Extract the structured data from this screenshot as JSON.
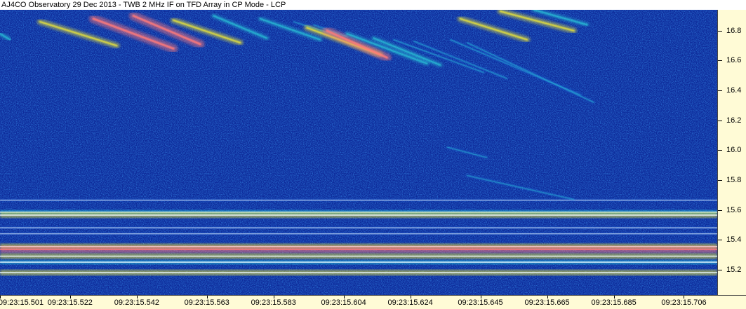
{
  "title": "AJ4CO Observatory 29 Dec 2013 - TWB 2 MHz IF on TFD Array in CP Mode - LCP",
  "colors": {
    "background_noise": "#0d2a9a",
    "low_intensity": "#1e5fd8",
    "mid_intensity": "#29c7d8",
    "high_intensity": "#e9e43a",
    "peak_intensity": "#ff7a7a",
    "axis_panel": "#fffbd6"
  },
  "chart_data": {
    "type": "heatmap",
    "title": "AJ4CO Observatory 29 Dec 2013 - TWB 2 MHz IF on TFD Array in CP Mode - LCP",
    "xlabel": "",
    "ylabel": "",
    "x_ticks": [
      "09:23:15.501",
      "09:23:15.522",
      "09:23:15.542",
      "09:23:15.563",
      "09:23:15.583",
      "09:23:15.604",
      "09:23:15.624",
      "09:23:15.645",
      "09:23:15.665",
      "09:23:15.685",
      "09:23:15.706"
    ],
    "y_ticks": [
      "16.8",
      "16.6",
      "16.4",
      "16.2",
      "16.0",
      "15.8",
      "15.6",
      "15.4",
      "15.2"
    ],
    "ylim": [
      15.03,
      16.94
    ],
    "xlim": [
      "09:23:15.501",
      "09:23:15.716"
    ],
    "grid": false,
    "y_axis_side": "right",
    "interference_bands_mhz": [
      {
        "f": 15.665,
        "level": "low"
      },
      {
        "f": 15.585,
        "level": "medium"
      },
      {
        "f": 15.565,
        "level": "high"
      },
      {
        "f": 15.48,
        "level": "low"
      },
      {
        "f": 15.44,
        "level": "low"
      },
      {
        "f": 15.355,
        "level": "high"
      },
      {
        "f": 15.335,
        "level": "peak"
      },
      {
        "f": 15.29,
        "level": "high"
      },
      {
        "f": 15.25,
        "level": "medium"
      },
      {
        "f": 15.18,
        "level": "high"
      }
    ],
    "emission_bursts": [
      {
        "t_start": 0.0,
        "f_start": 16.78,
        "t_end": 0.003,
        "f_end": 16.74,
        "level": "medium"
      },
      {
        "t_start": 0.012,
        "f_start": 16.86,
        "t_end": 0.035,
        "f_end": 16.7,
        "level": "high"
      },
      {
        "t_start": 0.028,
        "f_start": 16.88,
        "t_end": 0.052,
        "f_end": 16.68,
        "level": "peak"
      },
      {
        "t_start": 0.04,
        "f_start": 16.9,
        "t_end": 0.06,
        "f_end": 16.71,
        "level": "peak"
      },
      {
        "t_start": 0.052,
        "f_start": 16.87,
        "t_end": 0.072,
        "f_end": 16.72,
        "level": "high"
      },
      {
        "t_start": 0.064,
        "f_start": 16.9,
        "t_end": 0.08,
        "f_end": 16.75,
        "level": "medium"
      },
      {
        "t_start": 0.078,
        "f_start": 16.88,
        "t_end": 0.096,
        "f_end": 16.74,
        "level": "medium"
      },
      {
        "t_start": 0.088,
        "f_start": 16.86,
        "t_end": 0.101,
        "f_end": 16.77,
        "level": "low"
      },
      {
        "t_start": 0.094,
        "f_start": 16.84,
        "t_end": 0.104,
        "f_end": 16.76,
        "level": "low"
      },
      {
        "t_start": 0.092,
        "f_start": 16.82,
        "t_end": 0.114,
        "f_end": 16.64,
        "level": "high"
      },
      {
        "t_start": 0.098,
        "f_start": 16.8,
        "t_end": 0.116,
        "f_end": 16.62,
        "level": "peak"
      },
      {
        "t_start": 0.104,
        "f_start": 16.78,
        "t_end": 0.128,
        "f_end": 16.58,
        "level": "medium"
      },
      {
        "t_start": 0.112,
        "f_start": 16.75,
        "t_end": 0.132,
        "f_end": 16.57,
        "level": "medium"
      },
      {
        "t_start": 0.118,
        "f_start": 16.74,
        "t_end": 0.145,
        "f_end": 16.52,
        "level": "low"
      },
      {
        "t_start": 0.124,
        "f_start": 16.73,
        "t_end": 0.152,
        "f_end": 16.48,
        "level": "low"
      },
      {
        "t_start": 0.135,
        "f_start": 16.74,
        "t_end": 0.174,
        "f_end": 16.37,
        "level": "low"
      },
      {
        "t_start": 0.14,
        "f_start": 16.72,
        "t_end": 0.178,
        "f_end": 16.32,
        "level": "low"
      },
      {
        "t_start": 0.138,
        "f_start": 16.88,
        "t_end": 0.158,
        "f_end": 16.74,
        "level": "high"
      },
      {
        "t_start": 0.15,
        "f_start": 16.93,
        "t_end": 0.172,
        "f_end": 16.8,
        "level": "high"
      },
      {
        "t_start": 0.16,
        "f_start": 16.94,
        "t_end": 0.176,
        "f_end": 16.84,
        "level": "medium"
      },
      {
        "t_start": 0.134,
        "f_start": 16.02,
        "t_end": 0.146,
        "f_end": 15.95,
        "level": "low"
      },
      {
        "t_start": 0.14,
        "f_start": 15.83,
        "t_end": 0.172,
        "f_end": 15.67,
        "level": "low"
      }
    ]
  }
}
